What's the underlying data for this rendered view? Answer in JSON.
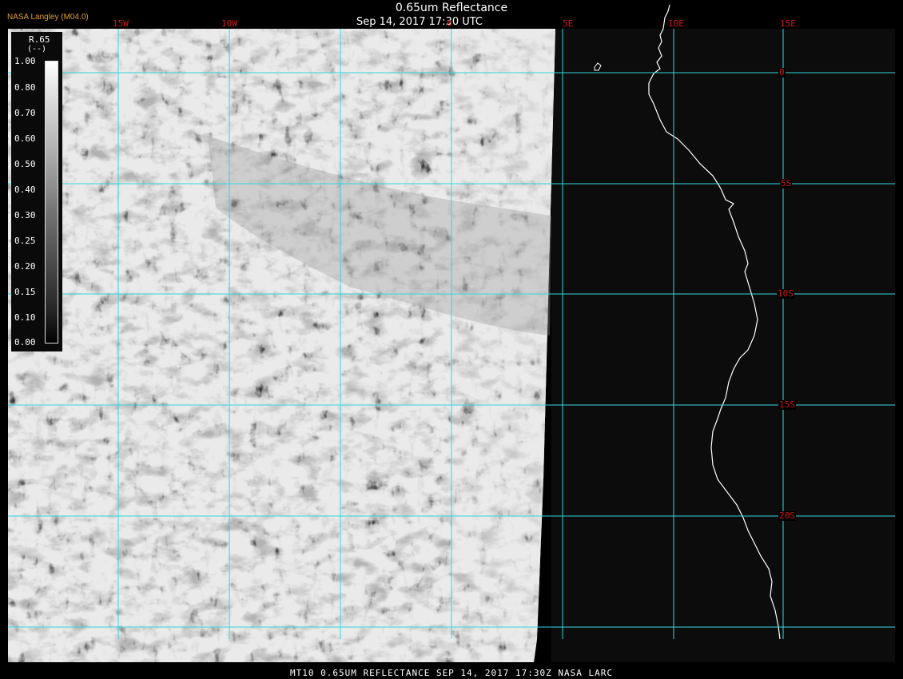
{
  "header": {
    "title": "0.65um Reflectance",
    "datetime": "Sep 14, 2017 17:30 UTC",
    "org": "NASA Langley (M04.0)"
  },
  "legend": {
    "title": "R.65",
    "units": "(--)",
    "ticks": [
      "1.00",
      "0.80",
      "0.70",
      "0.60",
      "0.50",
      "0.40",
      "0.30",
      "0.25",
      "0.20",
      "0.15",
      "0.10",
      "0.00"
    ]
  },
  "longitude_labels": [
    "15W",
    "10W",
    "0",
    "5E",
    "10E",
    "15E"
  ],
  "latitude_labels": [
    "0",
    "5S",
    "10S",
    "15S",
    "20S"
  ],
  "footer": "MT10  0.65UM REFLECTANCE   SEP 14, 2017 17:30Z   NASA LARC",
  "colors": {
    "gridline": "#33d6e0",
    "label": "#d01818",
    "coastline": "#ffffff",
    "land": "#0c0c0c"
  }
}
